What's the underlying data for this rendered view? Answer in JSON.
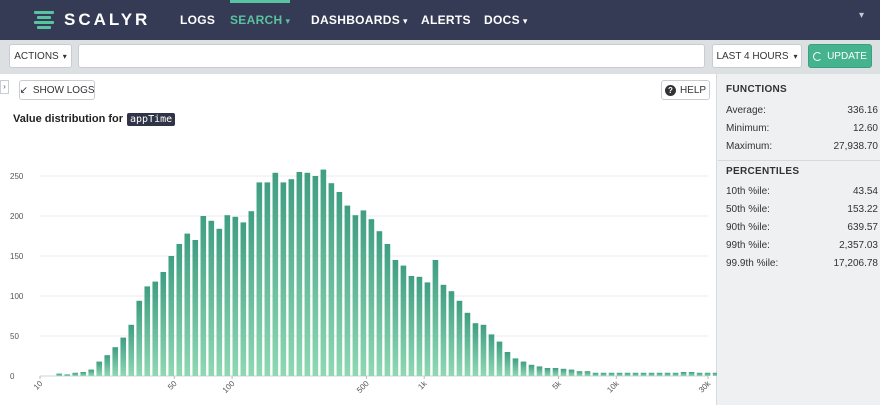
{
  "nav": {
    "logo": "SCALYR",
    "items": [
      {
        "label": "LOGS",
        "caret": ""
      },
      {
        "label": "SEARCH",
        "caret": "▾"
      },
      {
        "label": "DASHBOARDS",
        "caret": "▾"
      },
      {
        "label": "ALERTS",
        "caret": ""
      },
      {
        "label": "DOCS",
        "caret": "▾"
      }
    ]
  },
  "toolbar": {
    "actions_label": "ACTIONS",
    "search_placeholder": "",
    "time_range": "LAST 4 HOURS",
    "update_label": "UPDATE"
  },
  "panel": {
    "show_logs_label": "SHOW LOGS",
    "help_label": "HELP",
    "title_prefix": "Value distribution for",
    "field": "appTime"
  },
  "functions": {
    "heading": "FUNCTIONS",
    "rows": [
      {
        "label": "Average:",
        "value": "336.16"
      },
      {
        "label": "Minimum:",
        "value": "12.60"
      },
      {
        "label": "Maximum:",
        "value": "27,938.70"
      }
    ]
  },
  "percentiles": {
    "heading": "PERCENTILES",
    "rows": [
      {
        "label": "10th %ile:",
        "value": "43.54"
      },
      {
        "label": "50th %ile:",
        "value": "153.22"
      },
      {
        "label": "90th %ile:",
        "value": "639.57"
      },
      {
        "label": "99th %ile:",
        "value": "2,357.03"
      },
      {
        "label": "99.9th %ile:",
        "value": "17,206.78"
      }
    ]
  },
  "colors": {
    "nav_bg": "#353b55",
    "accent": "#59c2a0",
    "bar_top": "#3f9e82",
    "bar_bottom": "#8fd8b3"
  },
  "chart_data": {
    "type": "bar",
    "x_scale": "log",
    "xlim": [
      10,
      30000
    ],
    "ylim": [
      0,
      270
    ],
    "y_ticks": [
      0,
      50,
      100,
      150,
      200,
      250
    ],
    "x_ticks": [
      {
        "value": 10,
        "label": "10"
      },
      {
        "value": 50,
        "label": "50"
      },
      {
        "value": 100,
        "label": "100"
      },
      {
        "value": 500,
        "label": "500"
      },
      {
        "value": 1000,
        "label": "1k"
      },
      {
        "value": 5000,
        "label": "5k"
      },
      {
        "value": 10000,
        "label": "10k"
      },
      {
        "value": 30000,
        "label": "30k"
      }
    ],
    "bin_start": 12,
    "bins_per_decade": 24,
    "values": [
      3,
      2,
      4,
      5,
      8,
      18,
      26,
      36,
      48,
      64,
      94,
      112,
      118,
      130,
      150,
      165,
      178,
      170,
      200,
      194,
      184,
      201,
      199,
      192,
      206,
      242,
      242,
      254,
      242,
      246,
      255,
      254,
      250,
      258,
      241,
      230,
      213,
      201,
      207,
      196,
      181,
      165,
      145,
      138,
      125,
      124,
      117,
      145,
      114,
      106,
      94,
      79,
      66,
      64,
      52,
      43,
      30,
      22,
      18,
      14,
      12,
      10,
      10,
      9,
      8,
      6,
      6,
      4,
      4,
      4,
      4,
      4,
      4,
      4,
      4,
      4,
      4,
      4,
      5,
      5,
      4,
      4,
      4,
      4,
      5,
      4,
      9,
      4,
      4,
      4,
      4,
      4,
      4,
      4,
      4,
      4,
      4,
      4,
      4,
      4,
      4,
      4,
      4,
      4,
      4,
      4,
      4,
      4,
      4,
      4,
      4,
      4
    ]
  }
}
